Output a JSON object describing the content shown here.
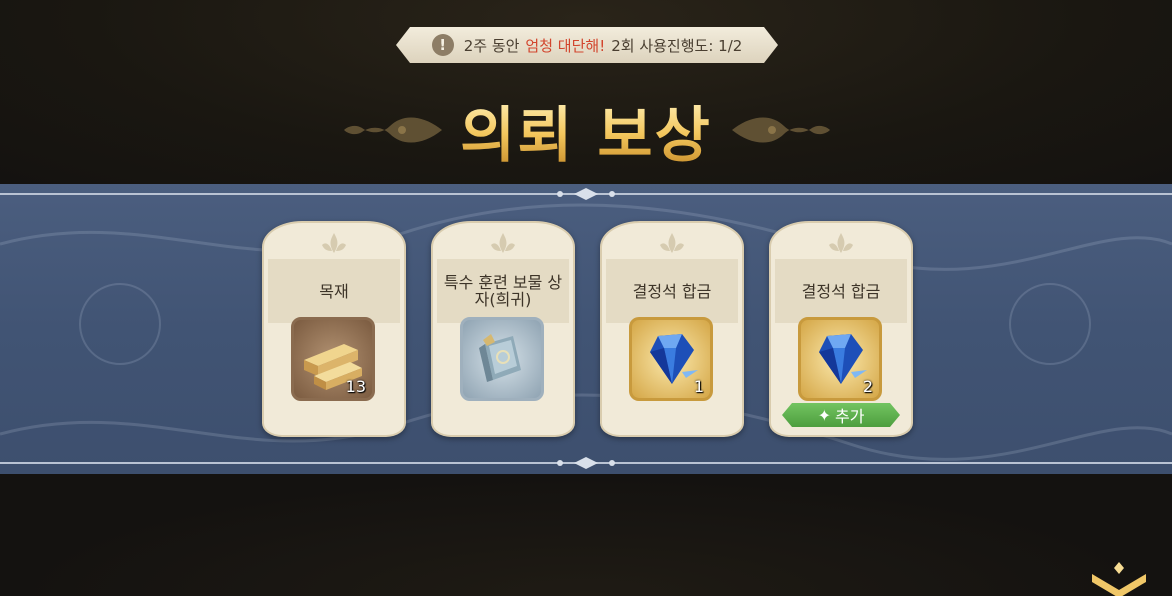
{
  "notice": {
    "part1": "2주 동안",
    "highlight": "엄청 대단해!",
    "part2": "2회 사용진행도: 1/2"
  },
  "title": "의뢰 보상",
  "rewards": [
    {
      "name": "목재",
      "icon": "wood-planks-icon",
      "quantity": "13",
      "frame": "brown"
    },
    {
      "name": "특수 훈련 보물 상자(희귀)",
      "icon": "treasure-box-icon",
      "quantity": "",
      "frame": "silver"
    },
    {
      "name": "결정석 합금",
      "icon": "blue-crystal-icon",
      "quantity": "1",
      "frame": "gold"
    },
    {
      "name": "결정석 합금",
      "icon": "blue-crystal-icon",
      "quantity": "2",
      "frame": "gold",
      "badge": "추가"
    }
  ],
  "colors": {
    "title_gold": "#f3c65c",
    "band_blue": "#445777",
    "highlight_red": "#d2452d",
    "badge_green": "#5aab48"
  }
}
